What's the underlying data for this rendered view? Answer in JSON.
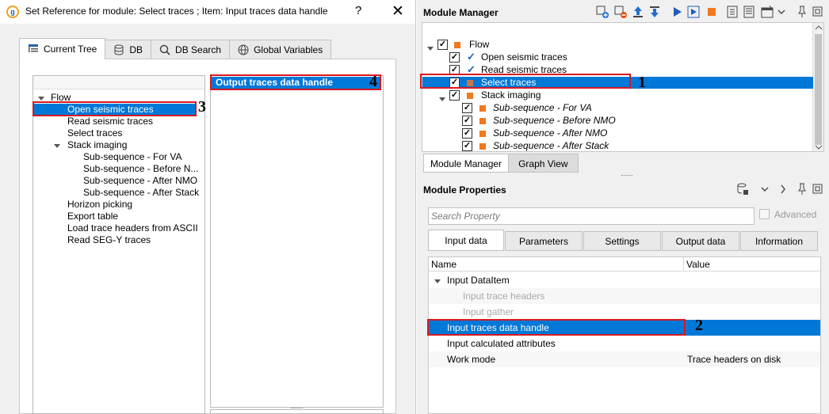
{
  "dialog": {
    "title": "Set Reference for module: Select traces ; Item: Input traces data handle",
    "help_label": "?",
    "close_label": "✕",
    "logo_text": "g",
    "tabs": [
      {
        "label": "Current Tree",
        "icon": "tree-icon"
      },
      {
        "label": "DB",
        "icon": "database-icon"
      },
      {
        "label": "DB Search",
        "icon": "search-icon"
      },
      {
        "label": "Global Variables",
        "icon": "globe-icon"
      }
    ],
    "tree": {
      "root": "Flow",
      "items": [
        "Open seismic traces",
        "Read seismic traces",
        "Select traces",
        "Stack imaging"
      ],
      "subitems": [
        "Sub-sequence - For VA",
        "Sub-sequence - Before N...",
        "Sub-sequence - After NMO",
        "Sub-sequence - After Stack"
      ],
      "more": [
        "Horizon picking",
        "Export table",
        "Load trace headers from ASCII",
        "Read SEG-Y traces"
      ]
    },
    "output_items": [
      "Output traces data handle"
    ]
  },
  "module_manager": {
    "title": "Module Manager",
    "flow_label": "Flow",
    "items": [
      "Open seismic traces",
      "Read seismic traces",
      "Select traces",
      "Stack imaging"
    ],
    "subitems": [
      "Sub-sequence - For VA",
      "Sub-sequence - Before NMO",
      "Sub-sequence - After NMO",
      "Sub-sequence - After Stack"
    ],
    "bottom_tabs": [
      "Module Manager",
      "Graph View"
    ]
  },
  "module_properties": {
    "title": "Module Properties",
    "search_placeholder": "Search Property",
    "advanced_label": "Advanced",
    "tabs": [
      "Input data",
      "Parameters",
      "Settings",
      "Output data",
      "Information"
    ],
    "columns": {
      "name": "Name",
      "value": "Value"
    },
    "rows": [
      {
        "name": "Input DataItem",
        "value": ""
      },
      {
        "name": "Input trace headers",
        "value": ""
      },
      {
        "name": "Input gather",
        "value": ""
      },
      {
        "name": "Input traces data handle",
        "value": ""
      },
      {
        "name": "Input calculated attributes",
        "value": ""
      },
      {
        "name": "Work mode",
        "value": "Trace headers on disk"
      }
    ]
  },
  "annotations": [
    "1",
    "2",
    "3",
    "4"
  ],
  "colors": {
    "selection": "#0078d7",
    "annotation": "#d71920",
    "module_square": "#f07820"
  }
}
